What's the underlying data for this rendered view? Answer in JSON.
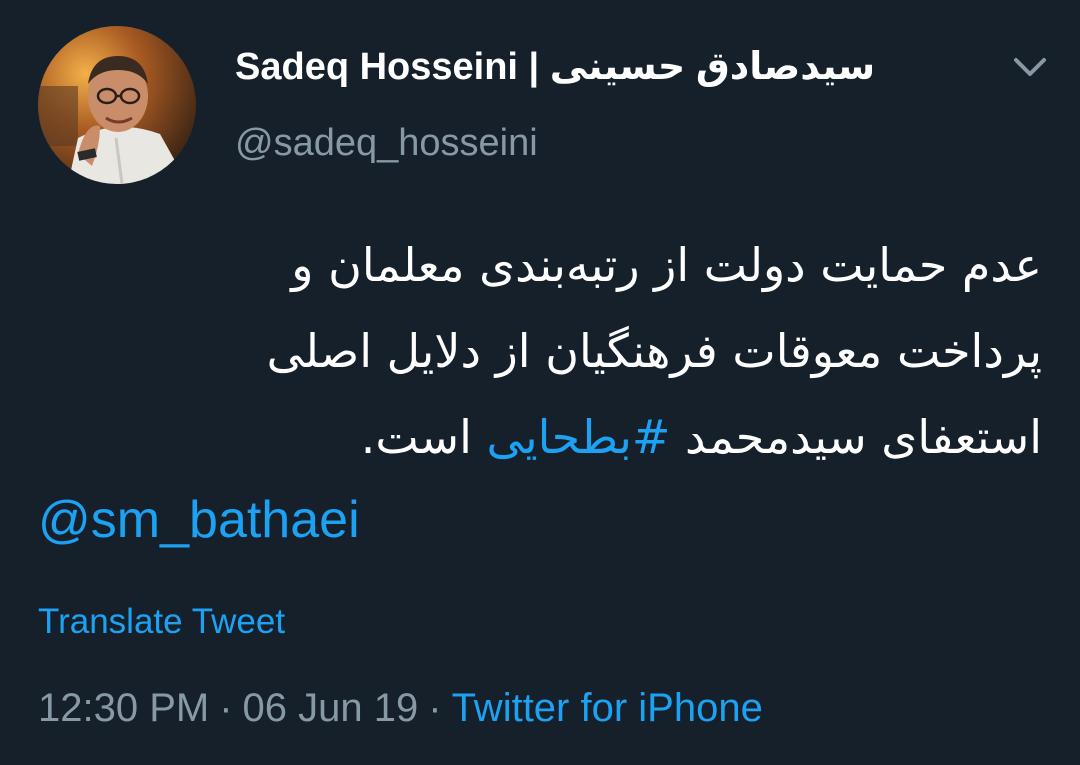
{
  "tweet": {
    "author": {
      "display_name": "Sadeq Hosseini | سیدصادق حسینی",
      "handle": "@sadeq_hosseini"
    },
    "menu_icon": "chevron-down-icon",
    "text_lines": [
      "عدم حمایت دولت از رتبه‌بندی معلمان و",
      "پرداخت معوقات فرهنگیان از دلایل اصلی",
      "استعفای سیدمحمد"
    ],
    "hashtag": "#بطحایی",
    "text_suffix": "است.",
    "mention": "@sm_bathaei",
    "translate_label": "Translate Tweet",
    "time": "12:30 PM",
    "separator": "·",
    "date": "06 Jun 19",
    "source": "Twitter for iPhone"
  },
  "colors": {
    "background": "#15202b",
    "primary_text": "#ffffff",
    "secondary_text": "#8899a6",
    "accent": "#1da1f2"
  }
}
